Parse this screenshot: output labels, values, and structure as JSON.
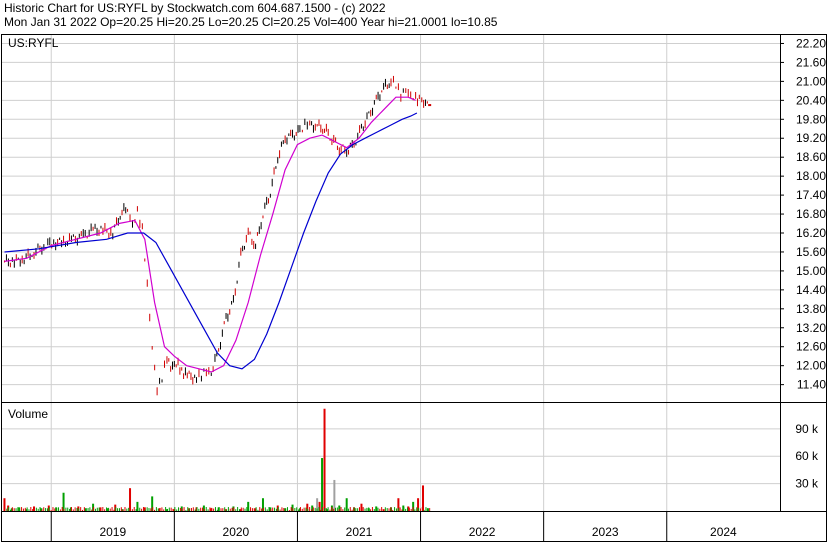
{
  "header": {
    "line1": "Historic Chart for US:RYFL by Stockwatch.com 604.687.1500 - (c) 2022",
    "line2": "Mon Jan 31 2022   Op=20.25   Hi=20.25   Lo=20.25   Cl=20.25   Vol=400   Year hi=21.0001   lo=10.85"
  },
  "colors": {
    "frame": "#000000",
    "grid": "#cfcfcf",
    "price_up": "#000000",
    "price_down": "#d00000",
    "ma_short": "#d000d0",
    "ma_long": "#0000d0",
    "volume_up": "#00a000",
    "volume_down": "#e00000",
    "volume_neutral": "#a0a0a0"
  },
  "chart_data": [
    {
      "type": "line",
      "title": "US:RYFL",
      "ylim": [
        10.85,
        22.5
      ],
      "y_ticks": [
        "22.20",
        "21.60",
        "21.00",
        "20.40",
        "19.80",
        "19.20",
        "18.60",
        "18.00",
        "17.40",
        "16.80",
        "16.20",
        "15.60",
        "15.00",
        "14.40",
        "13.80",
        "13.20",
        "12.60",
        "12.00",
        "11.40"
      ],
      "x_ticks": [
        "2019",
        "2020",
        "2021",
        "2022",
        "2023",
        "2024"
      ],
      "xlim": [
        2018.6,
        2024.92
      ],
      "series": [
        {
          "x": [
            2018.62,
            2018.7,
            2018.78,
            2018.86,
            2018.94,
            2019.02,
            2019.1,
            2019.18,
            2019.26,
            2019.34,
            2019.42,
            2019.5,
            2019.56,
            2019.62,
            2019.66,
            2019.7,
            2019.74,
            2019.78,
            2019.82,
            2019.86,
            2019.9,
            2019.94,
            2019.97,
            2020.0,
            2020.03,
            2020.06,
            2020.09,
            2020.12,
            2020.15,
            2020.18,
            2020.22,
            2020.26,
            2020.3,
            2020.36,
            2020.42,
            2020.48,
            2020.54,
            2020.6,
            2020.66,
            2020.72,
            2020.78,
            2020.84,
            2020.9,
            2020.96,
            2021.02,
            2021.06,
            2021.1,
            2021.16,
            2021.22,
            2021.28,
            2021.34,
            2021.4,
            2021.46,
            2021.52,
            2021.58,
            2021.64,
            2021.7,
            2021.76,
            2021.8,
            2021.84,
            2021.88,
            2021.92,
            2021.96,
            2021.99,
            2022.01,
            2022.04,
            2022.07
          ],
          "values": [
            15.3,
            15.3,
            15.4,
            15.6,
            15.8,
            15.9,
            15.9,
            16.0,
            16.1,
            16.3,
            16.3,
            16.2,
            16.8,
            17.0,
            16.5,
            16.9,
            16.3,
            14.5,
            12.5,
            11.2,
            11.6,
            12.3,
            12.0,
            12.1,
            12.1,
            11.8,
            11.7,
            11.7,
            11.5,
            11.6,
            11.7,
            11.9,
            11.8,
            12.5,
            13.5,
            14.0,
            15.5,
            16.2,
            15.8,
            16.8,
            17.5,
            18.6,
            19.2,
            19.3,
            19.4,
            19.6,
            19.6,
            19.6,
            19.5,
            19.2,
            18.9,
            18.8,
            19.0,
            19.5,
            19.9,
            20.4,
            20.8,
            21.0,
            20.9,
            20.6,
            20.8,
            20.6,
            20.5,
            20.4,
            20.3,
            20.25,
            20.25
          ]
        },
        {
          "x": [
            2018.62,
            2018.8,
            2019.0,
            2019.2,
            2019.4,
            2019.55,
            2019.68,
            2019.76,
            2019.84,
            2019.92,
            2020.0,
            2020.1,
            2020.2,
            2020.3,
            2020.4,
            2020.5,
            2020.6,
            2020.7,
            2020.8,
            2020.9,
            2021.0,
            2021.1,
            2021.2,
            2021.3,
            2021.4,
            2021.5,
            2021.6,
            2021.7,
            2021.8,
            2021.9,
            2021.96
          ],
          "values": [
            15.3,
            15.4,
            15.8,
            16.0,
            16.2,
            16.5,
            16.6,
            16.0,
            14.0,
            12.6,
            12.3,
            12.0,
            11.9,
            11.8,
            12.0,
            12.8,
            14.0,
            15.5,
            16.8,
            18.2,
            19.0,
            19.2,
            19.3,
            19.1,
            18.9,
            19.2,
            19.7,
            20.1,
            20.5,
            20.5,
            20.4
          ]
        },
        {
          "x": [
            2018.62,
            2018.9,
            2019.2,
            2019.45,
            2019.62,
            2019.75,
            2019.85,
            2019.95,
            2020.05,
            2020.15,
            2020.25,
            2020.35,
            2020.45,
            2020.55,
            2020.65,
            2020.75,
            2020.85,
            2020.95,
            2021.05,
            2021.15,
            2021.25,
            2021.35,
            2021.45,
            2021.55,
            2021.65,
            2021.75,
            2021.85,
            2021.92,
            2021.97
          ],
          "values": [
            15.6,
            15.7,
            15.9,
            16.0,
            16.2,
            16.2,
            15.9,
            15.2,
            14.5,
            13.8,
            13.1,
            12.4,
            12.0,
            11.9,
            12.2,
            13.0,
            14.0,
            15.1,
            16.2,
            17.2,
            18.1,
            18.7,
            19.0,
            19.2,
            19.4,
            19.6,
            19.8,
            19.9,
            20.0
          ]
        }
      ]
    },
    {
      "type": "bar",
      "title": "Volume",
      "ylim": [
        0,
        115
      ],
      "y_ticks": [
        "90 k",
        "60 k",
        "30 k"
      ],
      "series": [
        {
          "x": [
            2018.62,
            2018.65,
            2018.68,
            2018.74,
            2018.8,
            2018.86,
            2018.92,
            2018.98,
            2019.04,
            2019.1,
            2019.16,
            2019.22,
            2019.28,
            2019.34,
            2019.4,
            2019.46,
            2019.52,
            2019.58,
            2019.64,
            2019.7,
            2019.76,
            2019.82,
            2019.88,
            2019.94,
            2020.0,
            2020.06,
            2020.12,
            2020.18,
            2020.24,
            2020.3,
            2020.36,
            2020.42,
            2020.48,
            2020.54,
            2020.6,
            2020.66,
            2020.72,
            2020.78,
            2020.84,
            2020.9,
            2020.96,
            2021.02,
            2021.08,
            2021.12,
            2021.16,
            2021.18,
            2021.2,
            2021.22,
            2021.24,
            2021.28,
            2021.3,
            2021.34,
            2021.4,
            2021.46,
            2021.52,
            2021.58,
            2021.64,
            2021.7,
            2021.76,
            2021.82,
            2021.86,
            2021.9,
            2021.94,
            2021.98,
            2022.02,
            2022.06
          ],
          "values": [
            14,
            6,
            3,
            4,
            2,
            5,
            3,
            6,
            4,
            20,
            4,
            5,
            3,
            8,
            4,
            3,
            7,
            2,
            25,
            10,
            4,
            16,
            3,
            2,
            2,
            5,
            3,
            4,
            6,
            3,
            4,
            2,
            5,
            2,
            10,
            3,
            14,
            4,
            6,
            3,
            7,
            3,
            8,
            6,
            14,
            10,
            58,
            112,
            2,
            6,
            34,
            6,
            14,
            4,
            8,
            3,
            5,
            2,
            4,
            14,
            6,
            5,
            10,
            14,
            28,
            3
          ],
          "direction": [
            "d",
            "d",
            "u",
            "u",
            "u",
            "d",
            "u",
            "d",
            "u",
            "u",
            "u",
            "d",
            "u",
            "u",
            "d",
            "u",
            "d",
            "u",
            "d",
            "u",
            "d",
            "u",
            "d",
            "u",
            "d",
            "u",
            "d",
            "d",
            "u",
            "d",
            "u",
            "d",
            "u",
            "d",
            "u",
            "d",
            "u",
            "u",
            "d",
            "u",
            "u",
            "u",
            "d",
            "u",
            "n",
            "d",
            "u",
            "d",
            "u",
            "u",
            "n",
            "u",
            "u",
            "u",
            "d",
            "u",
            "u",
            "d",
            "u",
            "d",
            "u",
            "d",
            "u",
            "d",
            "d",
            "u"
          ]
        }
      ]
    }
  ]
}
